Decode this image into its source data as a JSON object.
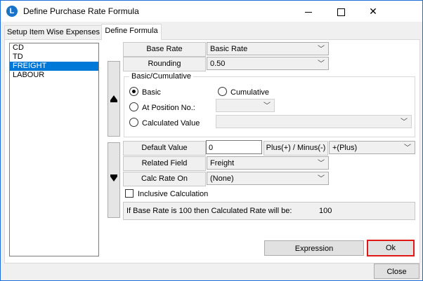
{
  "window": {
    "title": "Define Purchase Rate Formula",
    "icon": "app-logo-icon"
  },
  "tabs": [
    {
      "label": "Setup Item Wise Expenses",
      "active": false
    },
    {
      "label": "Define Formula",
      "active": true
    }
  ],
  "expense_list": {
    "items": [
      "CD",
      "TD",
      "FREIGHT",
      "LABOUR"
    ],
    "selected": "FREIGHT"
  },
  "formula": {
    "base_rate_label": "Base Rate",
    "base_rate_value": "Basic Rate",
    "rounding_label": "Rounding",
    "rounding_value": "0.50",
    "group_title": "Basic/Cumulative",
    "radio_basic": "Basic",
    "radio_cumulative": "Cumulative",
    "radio_at_position": "At Position No.:",
    "radio_calculated": "Calculated Value",
    "selected_radio": "Basic",
    "default_value_label": "Default Value",
    "default_value": "0",
    "plus_minus_label": "Plus(+) / Minus(-)",
    "plus_minus_value": "+(Plus)",
    "related_field_label": "Related Field",
    "related_field_value": "Freight",
    "calc_rate_on_label": "Calc Rate On",
    "calc_rate_on_value": "(None)",
    "inclusive_label": "Inclusive Calculation",
    "inclusive_checked": false,
    "info_text": "If Base Rate is 100 then Calculated Rate will be:",
    "info_value": "100"
  },
  "buttons": {
    "expression": "Expression",
    "ok": "Ok",
    "close": "Close"
  },
  "colors": {
    "selection": "#0078d7",
    "ok_border": "#e01818",
    "window_border": "#1e6fd9"
  }
}
